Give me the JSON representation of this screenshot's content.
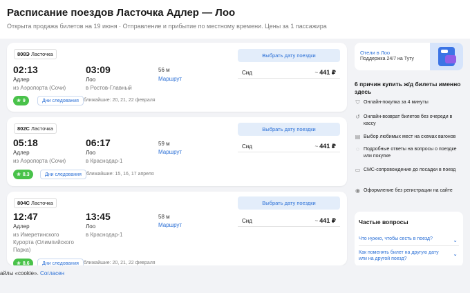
{
  "header": {
    "title": "Расписание поездов Ласточка Адлер — Лоо",
    "subtitle": "Открыта продажа билетов на 19 июня · Отправление и прибытие по местному времени. Цены за 1 пассажира"
  },
  "trains": [
    {
      "number": "808Э",
      "brand": "Ласточка",
      "dep_time": "02:13",
      "arr_time": "03:09",
      "dep_station": "Адлер",
      "dep_sub": "из Аэропорта (Сочи)",
      "arr_station": "Лоо",
      "arr_sub": "в Ростов-Главный",
      "duration": "56 м",
      "route_label": "Маршрут",
      "rating": "9",
      "days_label": "Дни следования",
      "nearest": "ближайшие: 20, 21, 22 февраля",
      "select_label": "Выбрать дату поездки",
      "seat_type": "Сид",
      "price": "441 ₽"
    },
    {
      "number": "802С",
      "brand": "Ласточка",
      "dep_time": "05:18",
      "arr_time": "06:17",
      "dep_station": "Адлер",
      "dep_sub": "из Аэропорта (Сочи)",
      "arr_station": "Лоо",
      "arr_sub": "в Краснодар-1",
      "duration": "59 м",
      "route_label": "Маршрут",
      "rating": "8.3",
      "days_label": "Дни следования",
      "nearest": "ближайшие: 15, 16, 17 апреля",
      "select_label": "Выбрать дату поездки",
      "seat_type": "Сид",
      "price": "441 ₽"
    },
    {
      "number": "804С",
      "brand": "Ласточка",
      "dep_time": "12:47",
      "arr_time": "13:45",
      "dep_station": "Адлер",
      "dep_sub": "из Имеретинского Курорта (Олимпийского Парка)",
      "arr_station": "Лоо",
      "arr_sub": "в Краснодар-1",
      "duration": "58 м",
      "route_label": "Маршрут",
      "rating": "8.6",
      "days_label": "Дни следования",
      "nearest": "ближайшие: 20, 21, 22 февраля",
      "select_label": "Выбрать дату поездки",
      "seat_type": "Сид",
      "price": "441 ₽"
    }
  ],
  "price_prefix": "~",
  "promo": {
    "title": "Отели в Лоо",
    "subtitle": "Поддержка 24/7 на Туту"
  },
  "reasons": {
    "title": "6 причин купить ж/д билеты именно здесь",
    "items": [
      "Онлайн-покупка за 4 минуты",
      "Онлайн-возврат билетов без очереди в кассу",
      "Выбор любимых мест на схемах вагонов",
      "Подробные ответы на вопросы о поездке или покупке",
      "СМС-сопровождение до посадки в поезд",
      "Оформление без регистрации на сайте"
    ]
  },
  "faq": {
    "title": "Частые вопросы",
    "items": [
      "Что нужно, чтобы сесть в поезд?",
      "Как поменять билет на другую дату или на другой поезд?"
    ]
  },
  "cookie": {
    "text": "айлы «cookie».",
    "agree": "Согласен"
  },
  "colors": {
    "accent": "#2a6fd6",
    "rating_green": "#49c24a",
    "button_bg": "#e3edfa"
  }
}
